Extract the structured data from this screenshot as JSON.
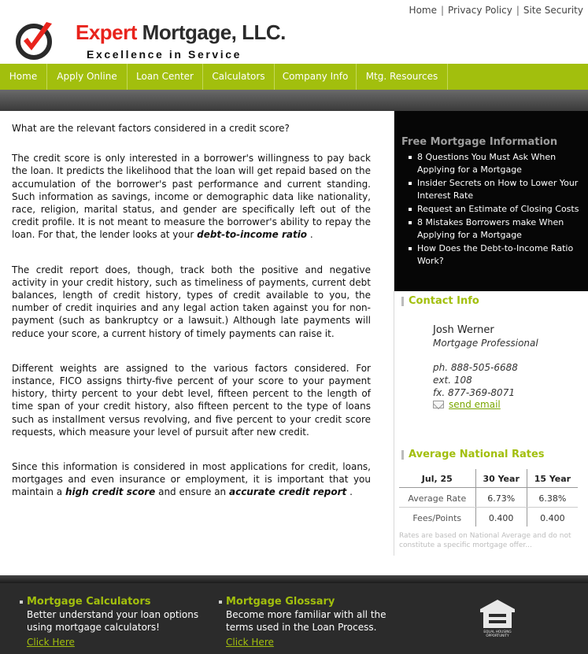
{
  "header": {
    "top_links": [
      "Home",
      "Privacy Policy",
      "Site Security"
    ],
    "brand_part1": "Expert",
    "brand_part2": "Mortgage, LLC.",
    "tagline": "Excellence in Service"
  },
  "nav": {
    "items": [
      "Home",
      "Apply Online",
      "Loan Center",
      "Calculators",
      "Company Info",
      "Mtg. Resources"
    ]
  },
  "main": {
    "question": "What are the relevant factors considered in a credit score?",
    "p1_a": "The credit score is only interested in a borrower's willingness to pay back the loan. It predicts the likelihood that the loan will get repaid based on the accumulation of the borrower's past performance and current standing. Such information as savings, income or demographic data like nationality, race, religion, marital status, and gender are specifically left out of the credit profile. It is not meant to measure the borrower's ability to repay the loan. For that, the lender looks at your ",
    "p1_em": "debt-to-income ratio",
    "p1_b": " .",
    "p2": "The credit report does, though, track both the positive and negative activity in your credit history, such as timeliness of payments, current debt balances, length of credit history, types of credit available to you, the number of credit inquiries and any legal action taken against you for non-payment (such as bankruptcy or a lawsuit.) Although late payments will reduce your score, a current history of timely payments can raise it.",
    "p3": "Different weights are assigned to the various factors considered. For instance, FICO assigns thirty-five percent of your score to your payment history, thirty percent to your debt level, fifteen percent to the length of time span of your credit history, also fifteen percent to the type of loans such as installment versus revolving, and five percent to your credit score requests, which measure your level of pursuit after new credit.",
    "p4_a": "Since this information is considered in most applications for credit, loans, mortgages and even insurance or employment, it is important that you maintain a ",
    "p4_em1": "high credit score",
    "p4_b": " and ensure an ",
    "p4_em2": "accurate credit report",
    "p4_c": " ."
  },
  "sidebar": {
    "free_title": "Free Mortgage Information",
    "free_items": [
      "8 Questions You Must Ask When Applying for a Mortgage",
      "Insider Secrets on How to Lower Your Interest Rate",
      "Request an Estimate of Closing Costs",
      "8 Mistakes Borrowers make When Applying for a Mortgage",
      "How Does the Debt-to-Income Ratio Work?"
    ],
    "contact_title": "Contact Info",
    "contact_name": "Josh Werner",
    "contact_role": "Mortgage Professional",
    "contact_phone": "ph. 888-505-6688",
    "contact_ext": "ext. 108",
    "contact_fax": "fx. 877-369-8071",
    "contact_email_label": "send email",
    "rates_title": "Average National Rates",
    "rates_date": "Jul, 25",
    "rates_col1": "30 Year",
    "rates_col2": "15 Year",
    "rates_row1_label": "Average Rate",
    "rates_row1_v1": "6.73%",
    "rates_row1_v2": "6.38%",
    "rates_row2_label": "Fees/Points",
    "rates_row2_v1": "0.400",
    "rates_row2_v2": "0.400",
    "rates_note": "Rates are based on National Average and do not constitute a specific mortgage offer..."
  },
  "footer": {
    "col1_title": "Mortgage Calculators",
    "col1_text": "Better understand your loan options using mortgage calculators!",
    "col1_link": "Click Here",
    "col2_title": "Mortgage Glossary",
    "col2_text": "Become more familiar with all the terms used in the Loan Process.",
    "col2_link": "Click Here",
    "eho_line1": "EQUAL HOUSING",
    "eho_line2": "OPPORTUNITY"
  },
  "colors": {
    "accent_green": "#a2bf0d",
    "brand_red": "#e8231c",
    "dark": "#060606"
  }
}
